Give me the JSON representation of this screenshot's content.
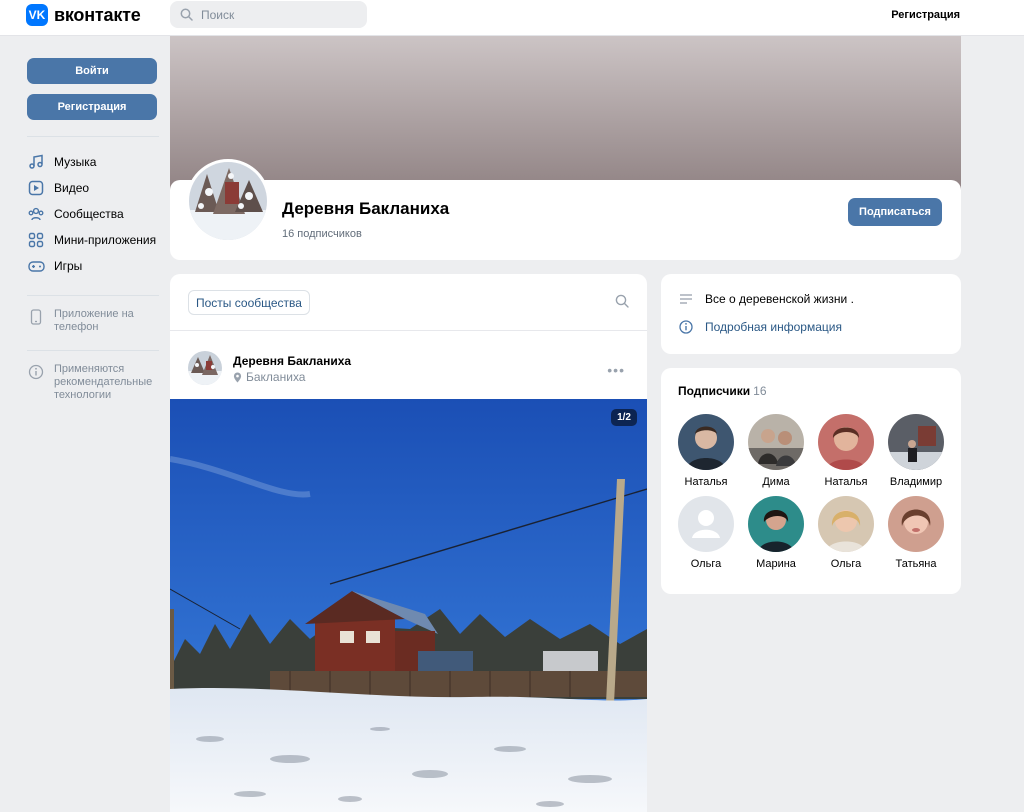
{
  "header": {
    "logo_mark": "VK",
    "logo_text": "вконтакте",
    "search_placeholder": "Поиск",
    "register_link": "Регистрация"
  },
  "sidebar": {
    "login_button": "Войти",
    "register_button": "Регистрация",
    "nav": [
      {
        "label": "Музыка",
        "icon": "music-icon"
      },
      {
        "label": "Видео",
        "icon": "video-icon"
      },
      {
        "label": "Сообщества",
        "icon": "communities-icon"
      },
      {
        "label": "Мини-приложения",
        "icon": "mini-apps-icon"
      },
      {
        "label": "Игры",
        "icon": "games-icon"
      }
    ],
    "app_note": "Приложение на телефон",
    "recommend_note": "Применяются рекомендательные технологии"
  },
  "profile": {
    "name": "Деревня Бакланиха",
    "subscribers": "16 подписчиков",
    "subscribe_button": "Подписаться"
  },
  "posts": {
    "tab_label": "Посты сообщества",
    "post": {
      "author": "Деревня Бакланиха",
      "location": "Бакланиха",
      "photo_counter": "1/2"
    }
  },
  "info": {
    "description": "Все о деревенской жизни .",
    "details_link": "Подробная информация"
  },
  "subscribers": {
    "title": "Подписчики",
    "count": "16",
    "people": [
      {
        "name": "Наталья"
      },
      {
        "name": "Дима"
      },
      {
        "name": "Наталья"
      },
      {
        "name": "Владимир"
      },
      {
        "name": "Ольга"
      },
      {
        "name": "Марина"
      },
      {
        "name": "Ольга"
      },
      {
        "name": "Татьяна"
      }
    ]
  },
  "colors": {
    "accent": "#4a76a8",
    "link": "#2a5885",
    "background": "#edeef0"
  }
}
